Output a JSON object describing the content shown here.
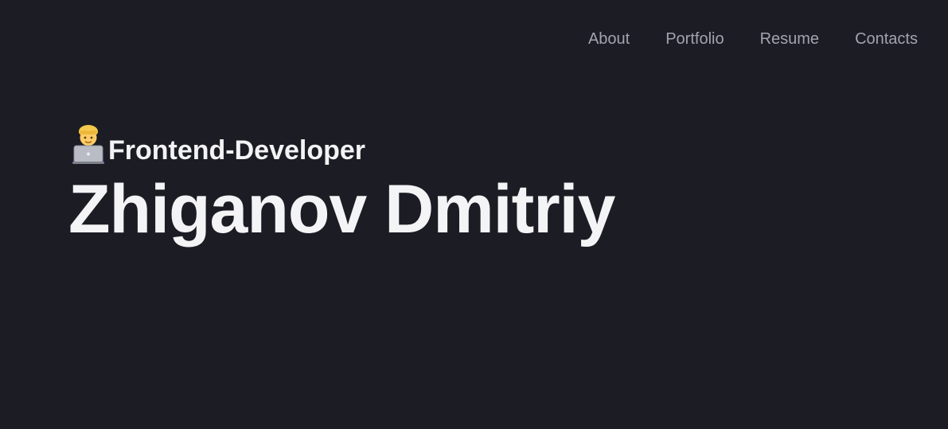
{
  "nav": {
    "items": [
      {
        "label": "About"
      },
      {
        "label": "Portfolio"
      },
      {
        "label": "Resume"
      },
      {
        "label": "Contacts"
      }
    ]
  },
  "hero": {
    "emoji_icon": "technologist-icon",
    "subtitle": "Frontend-Developer",
    "name": "Zhiganov Dmitriy"
  },
  "colors": {
    "background": "#1c1c24",
    "nav_text": "#a3a3b0",
    "heading_text": "#f3f3f5"
  }
}
